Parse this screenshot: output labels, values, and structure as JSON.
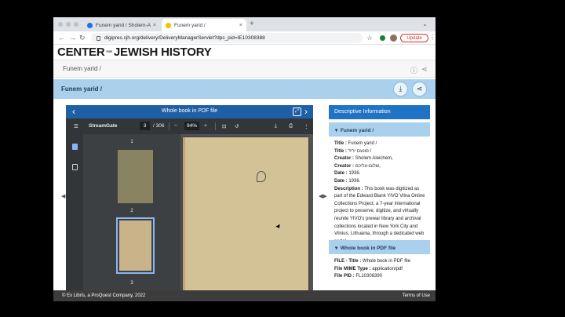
{
  "browser": {
    "tabs": [
      {
        "title": "Funem yarid / Sholem-Aleykhe...",
        "favicon_color": "#1a73e8"
      },
      {
        "title": "Funem yarid /",
        "favicon_color": "#fbbc04"
      }
    ],
    "url": "digipres.cjh.org/delivery/DeliveryManagerServlet?dps_pid=IE10308388",
    "update_label": "Update"
  },
  "site": {
    "logo_left": "CENTER",
    "logo_small_top": "FOR",
    "logo_small_bottom": "",
    "logo_right": "JEWISH HISTORY",
    "breadcrumb": "Funem yarid /",
    "record_title": "Funem yarid /"
  },
  "viewer": {
    "header": "Whole book in PDF file",
    "app_name": "StreamGate",
    "page_current": "3",
    "page_total": "/ 306",
    "zoom": "94%",
    "thumb_labels": [
      "1",
      "2",
      "3"
    ]
  },
  "panel": {
    "heading": "Descriptive Information",
    "section1": "Funem yarid /",
    "desc": [
      {
        "label": "Title :",
        "value": " Funem yarid /"
      },
      {
        "label": "Title :",
        "value": " פונעם יריד /"
      },
      {
        "label": "Creator :",
        "value": " Sholem Aleichem,"
      },
      {
        "label": "Creator :",
        "value": " שלום-עליכם,"
      },
      {
        "label": "Date :",
        "value": " 1936."
      },
      {
        "label": "Date :",
        "value": " 1936."
      },
      {
        "label": "Description :",
        "value": " This book was digitized as part of the Edward Blank YIVO Vilna Online Collections Project, a 7-year international project to preserve, digitize, and virtually reunite YIVO's prewar library and archival collections located in New York City and Vilnius, Lithuania, through a dedicated web portal."
      }
    ],
    "section2": "Whole book in PDF file",
    "file": [
      {
        "label": "FILE - Title :",
        "value": " Whole book in PDF file"
      },
      {
        "label": "File MIME Type :",
        "value": " application/pdf"
      },
      {
        "label": "File PID :",
        "value": " FL10308390"
      }
    ]
  },
  "footer": {
    "left": "© Ex Libris, a ProQuest Company, 2022",
    "right": "Terms of Use"
  }
}
